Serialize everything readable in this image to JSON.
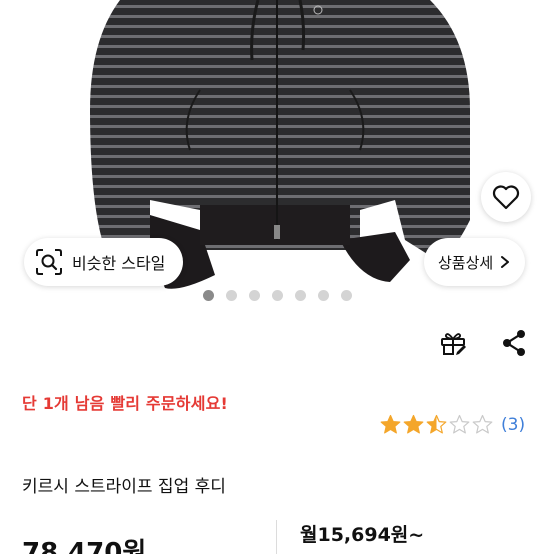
{
  "similar_style": {
    "label": "비슷한 스타일"
  },
  "product_detail": {
    "label": "상품상세"
  },
  "carousel": {
    "total": 7,
    "active_index": 0
  },
  "urgency_text": "단 1개 남음 빨리 주문하세요!",
  "rating": {
    "stars": 2.5,
    "max": 5,
    "review_count": "(3)"
  },
  "product": {
    "title": "키르시 스트라이프 집업 후디",
    "price": "78,470원",
    "monthly_price": "월15,694원~"
  },
  "colors": {
    "urgency": "#e53a35",
    "star_filled": "#f4a62a",
    "link_blue": "#3f7fd9"
  }
}
